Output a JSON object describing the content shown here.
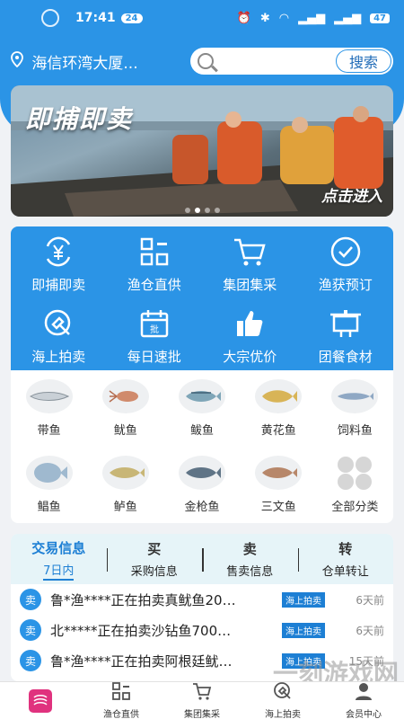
{
  "status_bar": {
    "time": "17:41",
    "notif_count": "24",
    "battery": "47"
  },
  "header": {
    "location": "海信环湾大厦...",
    "search_placeholder": "",
    "search_button": "搜索"
  },
  "banner": {
    "title": "即捕即卖",
    "enter_label": "点击进入"
  },
  "menu": [
    {
      "label": "即捕即卖",
      "icon": "yen-exchange-icon"
    },
    {
      "label": "渔仓直供",
      "icon": "grid-icon"
    },
    {
      "label": "集团集采",
      "icon": "cart-icon"
    },
    {
      "label": "渔获预订",
      "icon": "check-circle-icon"
    },
    {
      "label": "海上拍卖",
      "icon": "auction-icon"
    },
    {
      "label": "每日速批",
      "icon": "calendar-icon"
    },
    {
      "label": "大宗优价",
      "icon": "thumbs-up-icon"
    },
    {
      "label": "团餐食材",
      "icon": "food-tray-icon"
    }
  ],
  "fish": [
    {
      "label": "带鱼"
    },
    {
      "label": "鱿鱼"
    },
    {
      "label": "鲅鱼"
    },
    {
      "label": "黄花鱼"
    },
    {
      "label": "饲料鱼"
    },
    {
      "label": "鲳鱼"
    },
    {
      "label": "鲈鱼"
    },
    {
      "label": "金枪鱼"
    },
    {
      "label": "三文鱼"
    },
    {
      "label": "全部分类"
    }
  ],
  "trade": {
    "tabs": [
      {
        "main": "交易信息",
        "sub": "7日内"
      },
      {
        "main": "买",
        "sub": "采购信息"
      },
      {
        "main": "卖",
        "sub": "售卖信息"
      },
      {
        "main": "转",
        "sub": "仓单转让"
      }
    ],
    "rows": [
      {
        "badge": "卖",
        "text": "鲁*渔****正在拍卖真鱿鱼20…",
        "tag": "海上拍卖",
        "time": "6天前"
      },
      {
        "badge": "卖",
        "text": "北*****正在拍卖沙钻鱼700…",
        "tag": "海上拍卖",
        "time": "6天前"
      },
      {
        "badge": "卖",
        "text": "鲁*渔****正在拍卖阿根廷鱿…",
        "tag": "海上拍卖",
        "time": "15天前"
      }
    ]
  },
  "bottom_nav": [
    {
      "label": "",
      "icon": "home-logo-icon"
    },
    {
      "label": "渔仓直供",
      "icon": "grid-icon"
    },
    {
      "label": "集团集采",
      "icon": "cart-icon"
    },
    {
      "label": "海上拍卖",
      "icon": "auction-icon"
    },
    {
      "label": "会员中心",
      "icon": "user-icon"
    }
  ],
  "watermark": "一刻游戏网",
  "colors": {
    "primary": "#2b94e6",
    "tag": "#1d7fd4",
    "logo": "#e0327e"
  }
}
